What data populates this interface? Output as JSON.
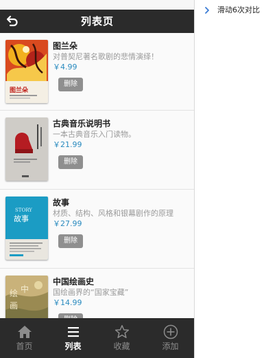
{
  "header": {
    "title": "列表页",
    "back_icon": "back-arrow-icon"
  },
  "books": [
    {
      "name": "图兰朵",
      "desc": "对普契尼著名歌剧的悲情演绎！",
      "price": "￥4.99",
      "delete_label": "删除"
    },
    {
      "name": "古典音乐说明书",
      "desc": "一本古典音乐入门读物。",
      "price": "￥21.99",
      "delete_label": "删除"
    },
    {
      "name": "故事",
      "desc": "材质、结构、风格和银幕剧作的原理",
      "price": "￥27.99",
      "delete_label": "删除"
    },
    {
      "name": "中国绘画史",
      "desc": "国绘画界的“国家宝藏”",
      "price": "￥14.99",
      "delete_label": "删除"
    }
  ],
  "tabbar": {
    "tabs": [
      {
        "label": "首页",
        "icon": "home-icon",
        "active": false
      },
      {
        "label": "列表",
        "icon": "list-icon",
        "active": true
      },
      {
        "label": "收藏",
        "icon": "star-icon",
        "active": false
      },
      {
        "label": "添加",
        "icon": "plus-circle-icon",
        "active": false
      }
    ]
  },
  "right_panel": {
    "item_label": "滑动6次对比"
  },
  "colors": {
    "header_bg": "#2b2b2b",
    "price": "#2a8bbf",
    "delete_bg": "#8f8f8f",
    "tab_inactive": "#8c8c8c"
  }
}
